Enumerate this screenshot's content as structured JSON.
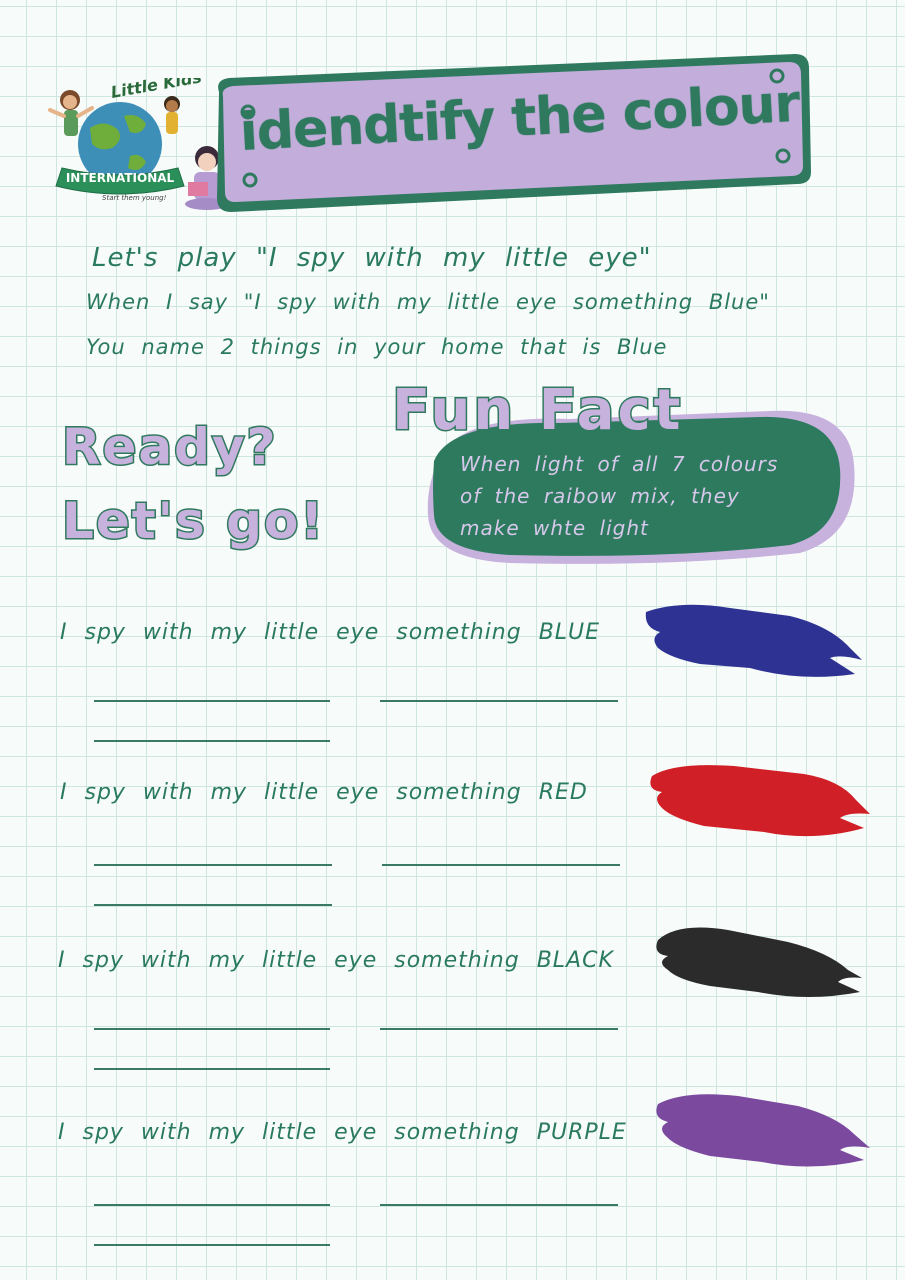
{
  "logo": {
    "brand_top": "Little Kids",
    "brand_ribbon": "INTERNATIONAL",
    "tagline": "Start them young!"
  },
  "title": "idendtify the colour",
  "instructions": [
    "Let's play \"I spy with my little eye\"",
    "When I say \"I spy with my little eye something Blue\"",
    "You name 2 things in your home that is Blue"
  ],
  "ready": "Ready?",
  "lets_go": "Let's go!",
  "fun_fact": {
    "title": "Fun Fact",
    "lines": [
      "When light of all 7 colours",
      "of the raibow mix, they",
      "make whte light"
    ]
  },
  "prompts": [
    {
      "text": "I spy with my little eye something BLUE",
      "color": "#2e3393"
    },
    {
      "text": "I spy with my little eye something RED",
      "color": "#d01f26"
    },
    {
      "text": "I spy with my little eye something BLACK",
      "color": "#2b2b2b"
    },
    {
      "text": "I spy with my little eye something PURPLE",
      "color": "#7b4a9f"
    }
  ],
  "colors": {
    "green": "#2f7a5f",
    "lavender": "#c7b1dd",
    "fact_bg": "#2e7a5f"
  }
}
